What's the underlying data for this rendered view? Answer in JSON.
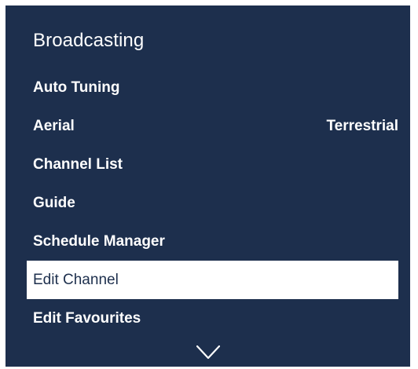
{
  "panel": {
    "title": "Broadcasting",
    "background_color": "#1d2f4d",
    "selected_color": "#ffffff"
  },
  "menu": {
    "items": [
      {
        "label": "Auto Tuning",
        "value": ""
      },
      {
        "label": "Aerial",
        "value": "Terrestrial"
      },
      {
        "label": "Channel List",
        "value": ""
      },
      {
        "label": "Guide",
        "value": ""
      },
      {
        "label": "Schedule Manager",
        "value": ""
      },
      {
        "label": "Edit Channel",
        "value": "",
        "selected": true
      },
      {
        "label": "Edit Favourites",
        "value": ""
      }
    ]
  },
  "scroll": {
    "icon": "chevron-down-icon"
  }
}
